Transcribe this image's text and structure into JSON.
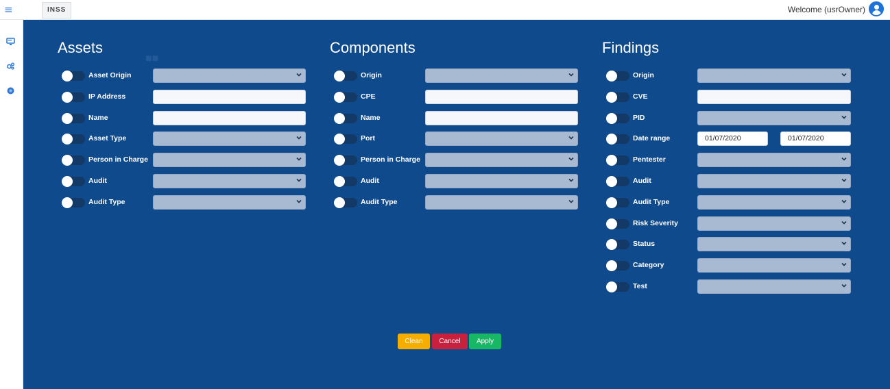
{
  "topbar": {
    "brand": "INSS",
    "welcome": "Welcome (usrOwner)"
  },
  "icons": {
    "menu": "hamburger-icon",
    "user": "user-avatar-icon",
    "rail": [
      "monitor-icon",
      "gears-icon",
      "circle-dot-icon"
    ]
  },
  "colors": {
    "overlay": "#0f4a8c",
    "clean": "#f5ad00",
    "cancel": "#c8203d",
    "apply": "#18b765"
  },
  "assets": {
    "title": "Assets",
    "rows": [
      {
        "label": "Asset Origin",
        "type": "select",
        "value": ""
      },
      {
        "label": "IP Address",
        "type": "text",
        "value": ""
      },
      {
        "label": "Name",
        "type": "text",
        "value": ""
      },
      {
        "label": "Asset Type",
        "type": "select",
        "value": ""
      },
      {
        "label": "Person in Charge",
        "type": "select",
        "value": ""
      },
      {
        "label": "Audit",
        "type": "select",
        "value": ""
      },
      {
        "label": "Audit Type",
        "type": "select",
        "value": ""
      }
    ]
  },
  "components": {
    "title": "Components",
    "rows": [
      {
        "label": "Origin",
        "type": "select",
        "value": ""
      },
      {
        "label": "CPE",
        "type": "text",
        "value": ""
      },
      {
        "label": "Name",
        "type": "text",
        "value": ""
      },
      {
        "label": "Port",
        "type": "select",
        "value": ""
      },
      {
        "label": "Person in Charge",
        "type": "select",
        "value": ""
      },
      {
        "label": "Audit",
        "type": "select",
        "value": ""
      },
      {
        "label": "Audit Type",
        "type": "select",
        "value": ""
      }
    ]
  },
  "findings": {
    "title": "Findings",
    "rows": [
      {
        "label": "Origin",
        "type": "select",
        "value": ""
      },
      {
        "label": "CVE",
        "type": "text",
        "value": ""
      },
      {
        "label": "PID",
        "type": "select",
        "value": ""
      },
      {
        "label": "Date range",
        "type": "daterange",
        "from": "01/07/2020",
        "to": "01/07/2020"
      },
      {
        "label": "Pentester",
        "type": "select",
        "value": ""
      },
      {
        "label": "Audit",
        "type": "select",
        "value": ""
      },
      {
        "label": "Audit Type",
        "type": "select",
        "value": ""
      },
      {
        "label": "Risk Severity",
        "type": "select",
        "value": ""
      },
      {
        "label": "Status",
        "type": "select",
        "value": ""
      },
      {
        "label": "Category",
        "type": "select",
        "value": ""
      },
      {
        "label": "Test",
        "type": "select",
        "value": ""
      }
    ]
  },
  "buttons": {
    "clean": "Clean",
    "cancel": "Cancel",
    "apply": "Apply"
  }
}
